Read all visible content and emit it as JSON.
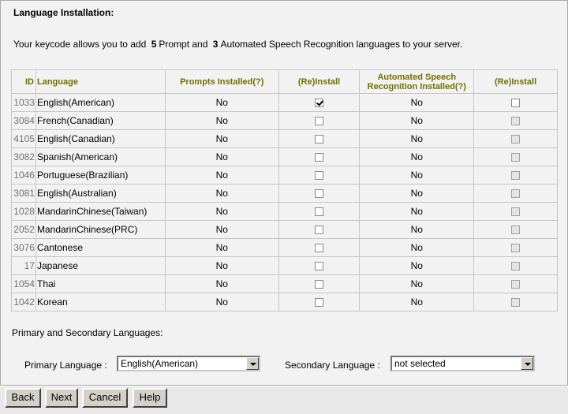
{
  "page": {
    "title": "Language Installation:",
    "keycode_prefix": "Your keycode allows you to add",
    "prompt_count": "5",
    "prompt_text": "Prompt and",
    "asr_count": "3",
    "asr_text": "Automated Speech Recognition languages to your server."
  },
  "table": {
    "headers": {
      "id": "ID",
      "language": "Language",
      "prompts_installed": "Prompts Installed(?)",
      "reinstall1": "(Re)Install",
      "asr_installed_line1": "Automated Speech",
      "asr_installed_line2": "Recognition Installed(?)",
      "reinstall2": "(Re)Install"
    },
    "rows": [
      {
        "id": "1033",
        "language": "English(American)",
        "prompts": "No",
        "prompt_checked": true,
        "prompt_enabled": true,
        "asr": "No",
        "asr_checked": false,
        "asr_enabled": true
      },
      {
        "id": "3084",
        "language": "French(Canadian)",
        "prompts": "No",
        "prompt_checked": false,
        "prompt_enabled": true,
        "asr": "No",
        "asr_checked": false,
        "asr_enabled": false
      },
      {
        "id": "4105",
        "language": "English(Canadian)",
        "prompts": "No",
        "prompt_checked": false,
        "prompt_enabled": true,
        "asr": "No",
        "asr_checked": false,
        "asr_enabled": false
      },
      {
        "id": "3082",
        "language": "Spanish(American)",
        "prompts": "No",
        "prompt_checked": false,
        "prompt_enabled": true,
        "asr": "No",
        "asr_checked": false,
        "asr_enabled": false
      },
      {
        "id": "1046",
        "language": "Portuguese(Brazilian)",
        "prompts": "No",
        "prompt_checked": false,
        "prompt_enabled": true,
        "asr": "No",
        "asr_checked": false,
        "asr_enabled": false
      },
      {
        "id": "3081",
        "language": "English(Australian)",
        "prompts": "No",
        "prompt_checked": false,
        "prompt_enabled": true,
        "asr": "No",
        "asr_checked": false,
        "asr_enabled": false
      },
      {
        "id": "1028",
        "language": "MandarinChinese(Taiwan)",
        "prompts": "No",
        "prompt_checked": false,
        "prompt_enabled": true,
        "asr": "No",
        "asr_checked": false,
        "asr_enabled": false
      },
      {
        "id": "2052",
        "language": "MandarinChinese(PRC)",
        "prompts": "No",
        "prompt_checked": false,
        "prompt_enabled": true,
        "asr": "No",
        "asr_checked": false,
        "asr_enabled": false
      },
      {
        "id": "3076",
        "language": "Cantonese",
        "prompts": "No",
        "prompt_checked": false,
        "prompt_enabled": true,
        "asr": "No",
        "asr_checked": false,
        "asr_enabled": false
      },
      {
        "id": "17",
        "language": "Japanese",
        "prompts": "No",
        "prompt_checked": false,
        "prompt_enabled": true,
        "asr": "No",
        "asr_checked": false,
        "asr_enabled": false
      },
      {
        "id": "1054",
        "language": "Thai",
        "prompts": "No",
        "prompt_checked": false,
        "prompt_enabled": true,
        "asr": "No",
        "asr_checked": false,
        "asr_enabled": false
      },
      {
        "id": "1042",
        "language": "Korean",
        "prompts": "No",
        "prompt_checked": false,
        "prompt_enabled": true,
        "asr": "No",
        "asr_checked": false,
        "asr_enabled": false
      }
    ]
  },
  "languages": {
    "section_label": "Primary and Secondary Languages:",
    "primary_label": "Primary Language :",
    "primary_value": "English(American)",
    "secondary_label": "Secondary Language :",
    "secondary_value": "not selected"
  },
  "buttons": {
    "back": "Back",
    "next": "Next",
    "cancel": "Cancel",
    "help": "Help"
  }
}
